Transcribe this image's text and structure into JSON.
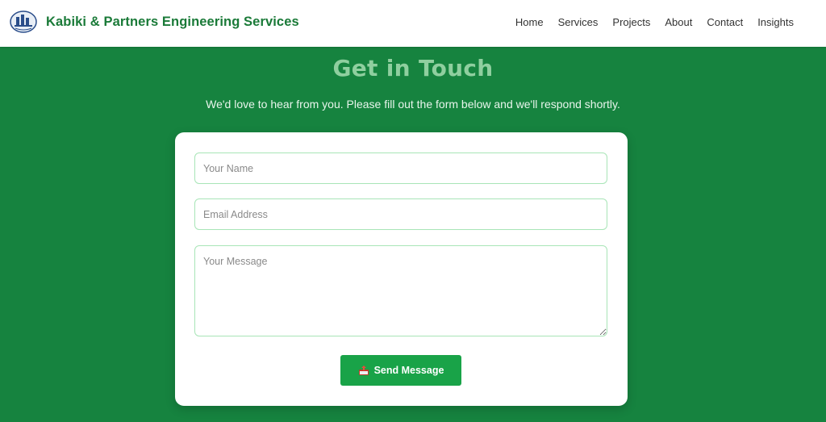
{
  "header": {
    "brand": "Kabiki & Partners Engineering Services",
    "logo_icon": "company-logo-icon",
    "nav": [
      {
        "label": "Home"
      },
      {
        "label": "Services"
      },
      {
        "label": "Projects"
      },
      {
        "label": "About"
      },
      {
        "label": "Contact"
      },
      {
        "label": "Insights"
      }
    ]
  },
  "contact": {
    "title": "Get in Touch",
    "subtitle": "We'd love to hear from you. Please fill out the form below and we'll respond shortly.",
    "name_placeholder": "Your Name",
    "email_placeholder": "Email Address",
    "message_placeholder": "Your Message",
    "submit_label": "Send Message",
    "submit_icon": "outbox-tray-icon"
  },
  "colors": {
    "background": "#16833f",
    "brand_text": "#1a7a38",
    "title": "#8fcf9f",
    "button": "#19a348",
    "field_border": "#a8e5b7"
  }
}
